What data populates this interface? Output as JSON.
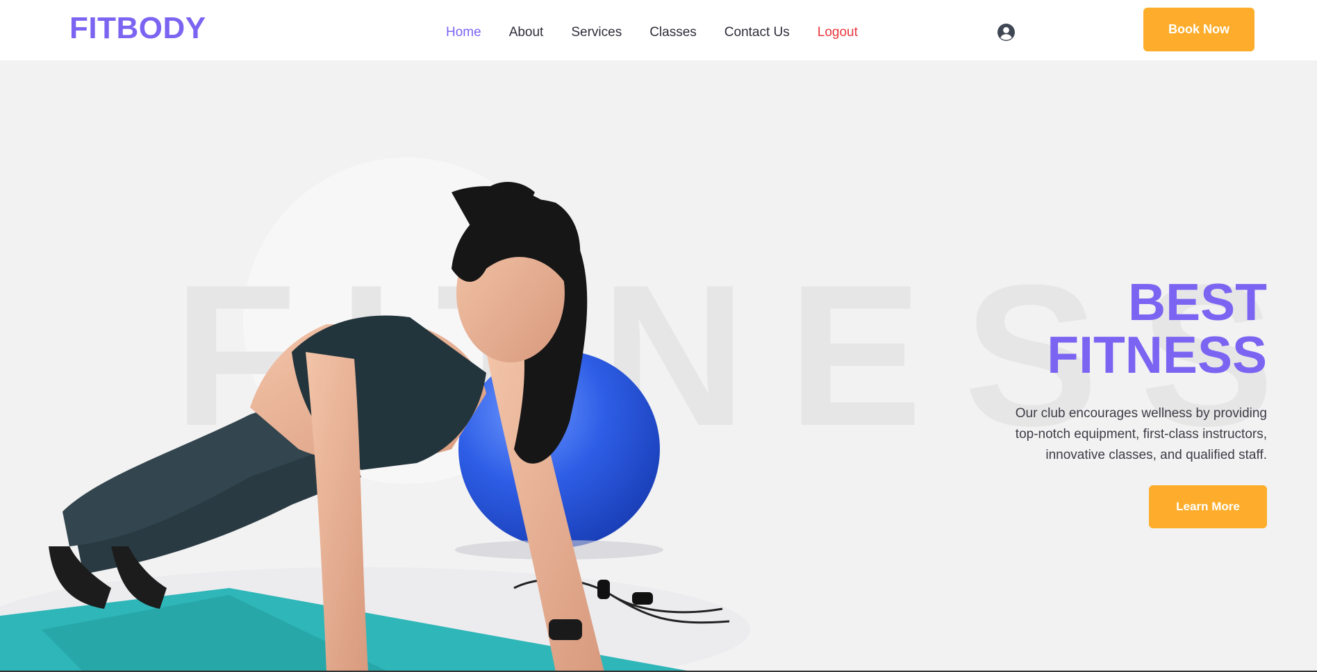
{
  "header": {
    "logo": "FITBODY",
    "nav": [
      {
        "label": "Home"
      },
      {
        "label": "About"
      },
      {
        "label": "Services"
      },
      {
        "label": "Classes"
      },
      {
        "label": "Contact Us"
      },
      {
        "label": "Logout"
      }
    ],
    "user_icon": "user-circle-icon",
    "book_button": "Book Now"
  },
  "hero": {
    "background_word": "FITNESS",
    "title_line1": "BEST",
    "title_line2": "FITNESS",
    "description_line1": "Our club encourages wellness by providing",
    "description_line2": "top-notch equipment, first-class instructors,",
    "description_line3": "innovative classes, and qualified staff.",
    "cta_button": "Learn More"
  },
  "colors": {
    "brand": "#7c64f2",
    "accent": "#fdad2b",
    "logout": "#e8363e",
    "text": "#2d2d3a"
  }
}
